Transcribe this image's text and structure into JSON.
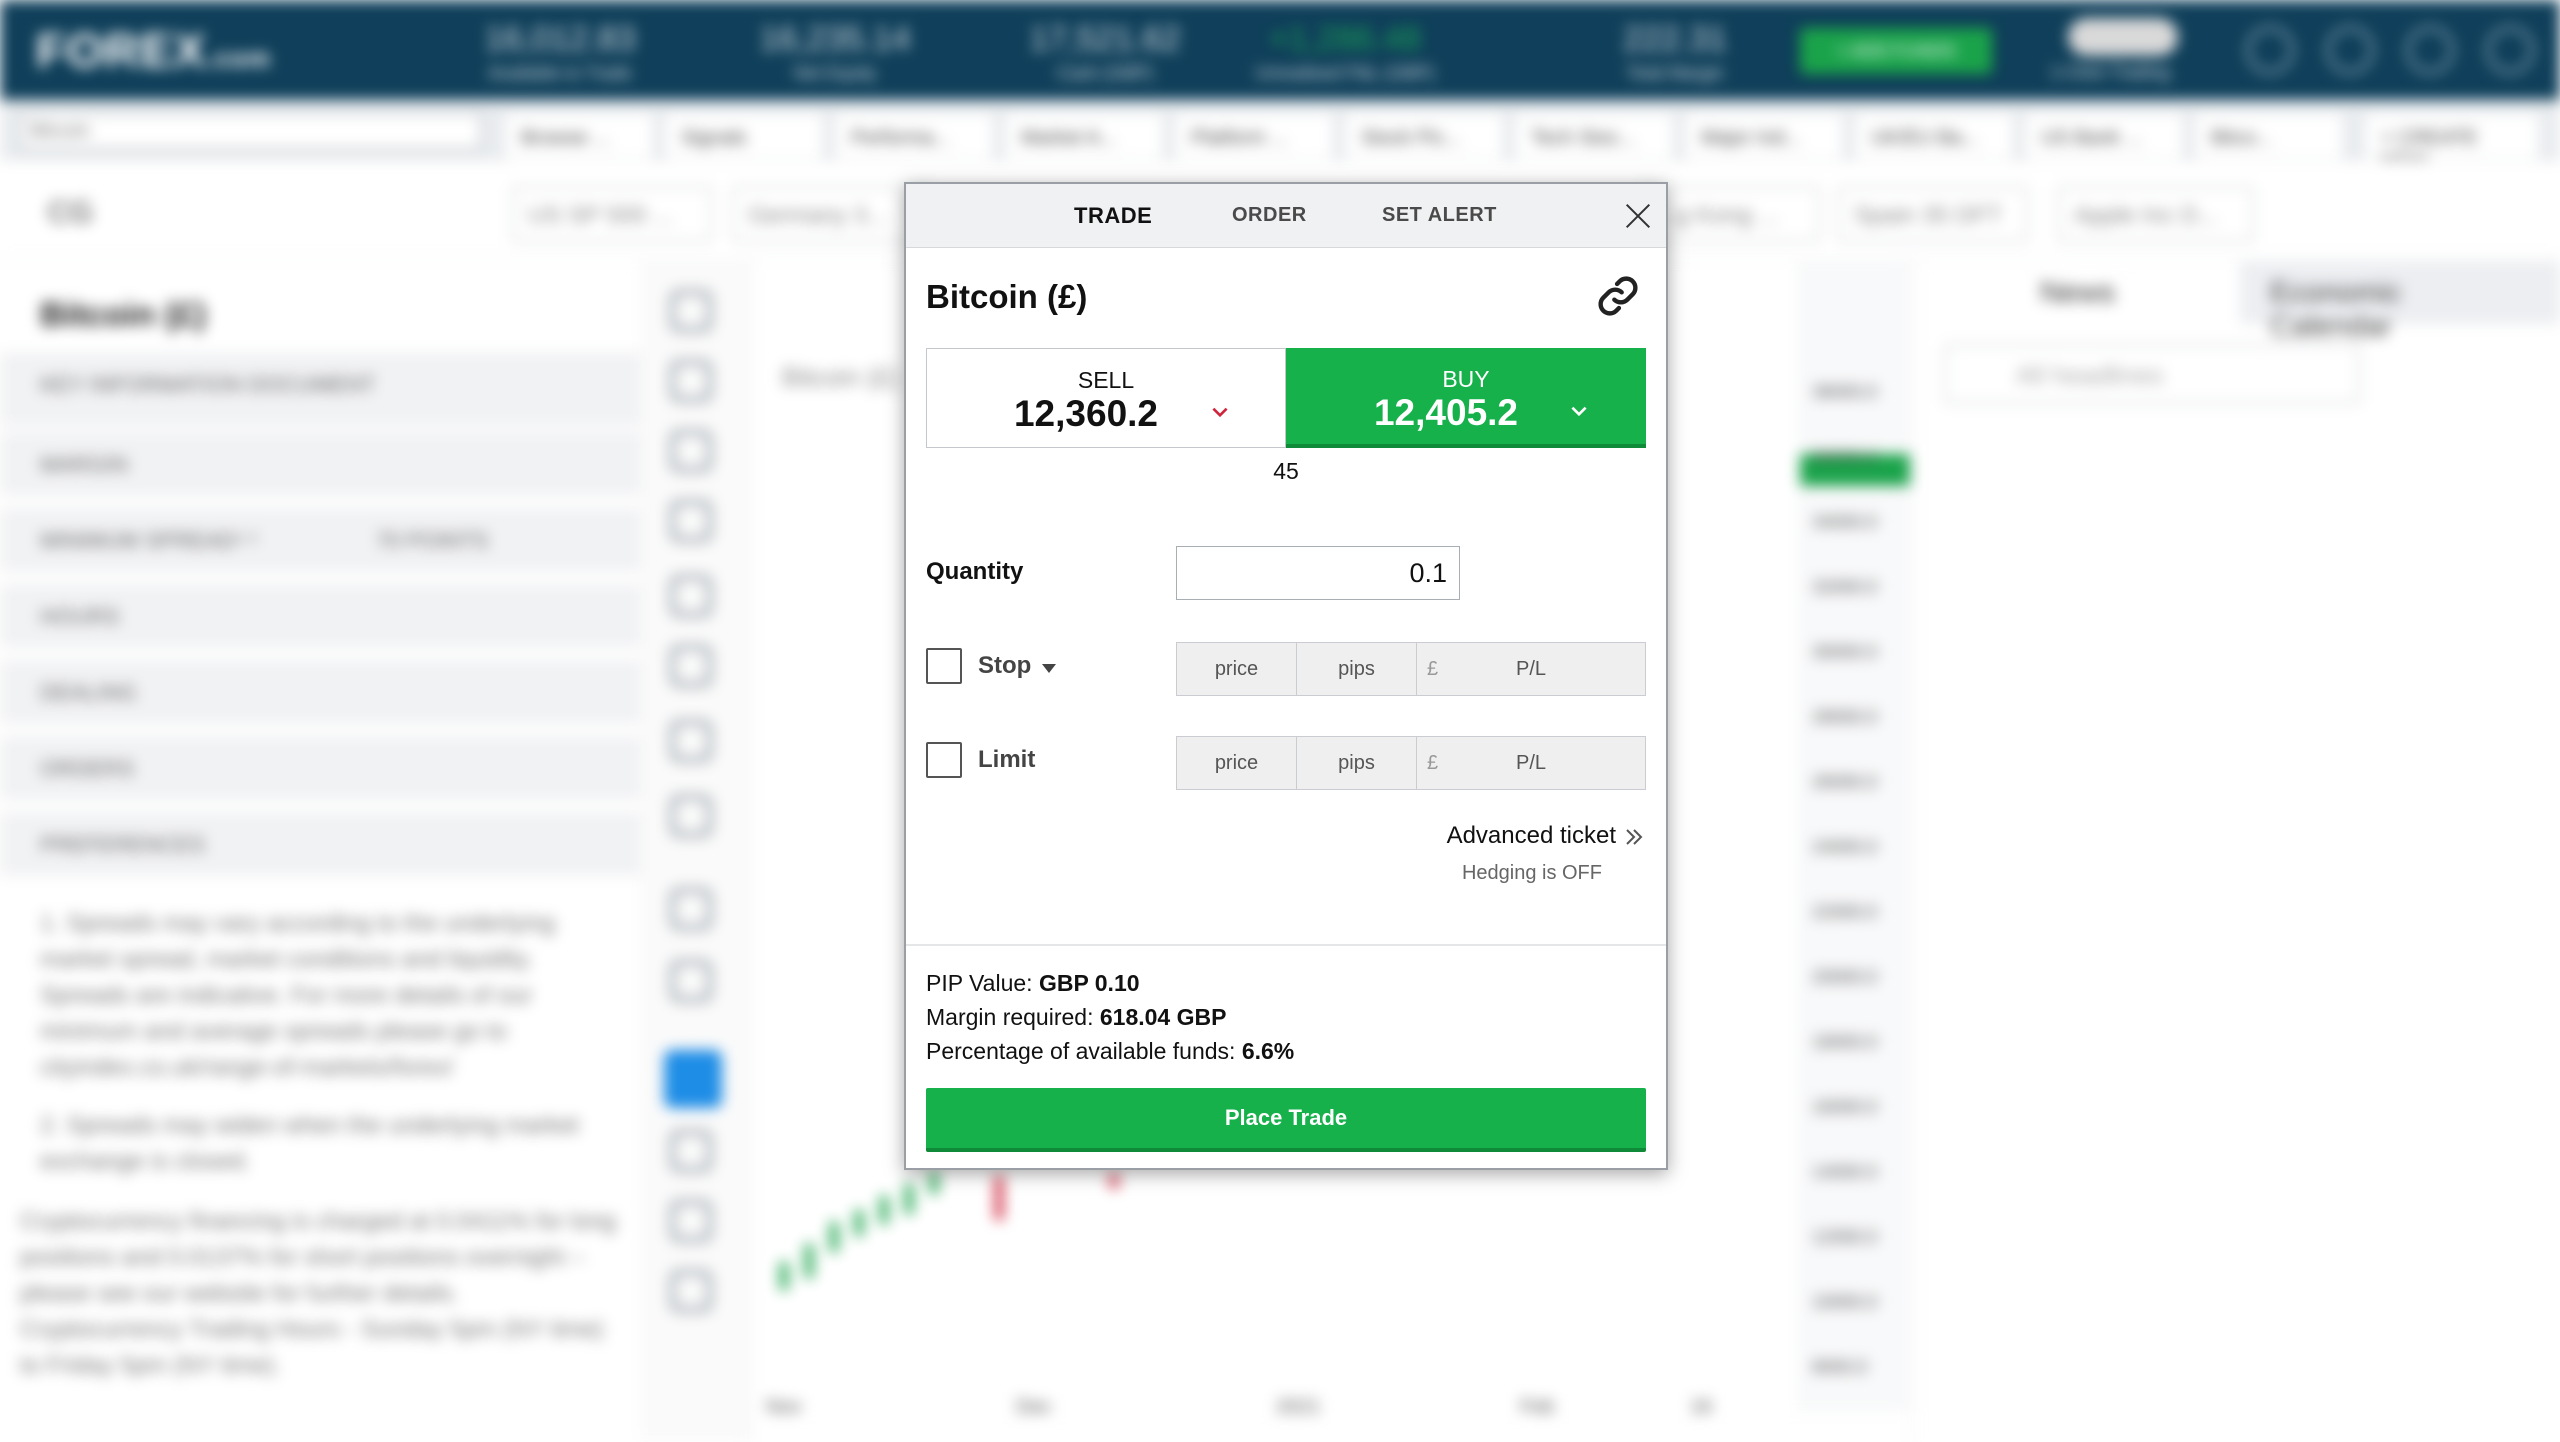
{
  "background": {
    "logo_main": "FOREX",
    "logo_suffix": ".com",
    "stats": [
      {
        "value": "16,012.83",
        "label": "Available to Trade"
      },
      {
        "value": "16,235.14",
        "label": "Net Equity"
      },
      {
        "value": "17,521.62",
        "label": "Cash (GBP)"
      },
      {
        "value": "+1,286.48",
        "label": "Unrealised P&L (GBP)"
      },
      {
        "value": "222.31",
        "label": "Total Margin"
      }
    ],
    "add_funds": "+ ADD FUNDS",
    "one_click_label": "1-Click Trading",
    "search_value": "Bitcoin",
    "tabs": [
      "Browse ...",
      "Signals",
      "Performa...",
      "Market A...",
      "Platform ...",
      "Stock Pic...",
      "Tech Stoc...",
      "Major Ind...",
      "UK/EU Ba...",
      "US Bank ...",
      "Bitco...",
      "+ CREATE NEW"
    ],
    "market_select": "CG",
    "markets": [
      "US SP 500 ...",
      "Germany 3...",
      "...g Kong ...",
      "Spain 35 DFT",
      "Apple Inc D..."
    ],
    "left_title": "Bitcoin (£)",
    "left_rows": [
      "KEY INFORMATION DOCUMENT",
      "MARGIN",
      "MINIMUM SPREAD¹ ²",
      "HOURS",
      "DEALING",
      "ORDERS",
      "PREFERENCES"
    ],
    "left_spread_value": "70 POINTS",
    "footnotes": [
      "1. Spreads may vary according to the underlying market spread, market conditions and liquidity. Spreads are indicative. For more details of our minimum and average spreads please go to cityindex.co.uk/range-of-markets/forex/",
      "2. Spreads may widen when the underlying market exchange is closed.",
      "Cryptocurrency financing is charged at 0.0411% for long positions and 0.0137% for short positions overnight – please see our website for further details. Cryptocurrency Trading Hours - Sunday 5pm (NY time) to Friday 5pm (NY time)."
    ],
    "chart_title": "Bitcoin (£)",
    "y_ticks": [
      "38000.0",
      "36000.0",
      "34000.0",
      "32000.0",
      "30000.0",
      "28000.0",
      "26000.0",
      "24000.0",
      "22000.0",
      "20000.0",
      "18000.0",
      "16000.0",
      "14000.0",
      "12000.0",
      "10000.0",
      "8000.0"
    ],
    "x_ticks": [
      "Nov",
      "Dec",
      "2021",
      "Feb",
      "16"
    ],
    "news_tab": "News",
    "econ_tab": "Economic Calendar",
    "news_search_placeholder": "All headlines"
  },
  "ticket": {
    "tabs": {
      "trade": "TRADE",
      "order": "ORDER",
      "alert": "SET ALERT"
    },
    "title": "Bitcoin (£)",
    "sell": {
      "label": "SELL",
      "price": "12,360.2"
    },
    "buy": {
      "label": "BUY",
      "price": "12,405.2"
    },
    "spread": "45",
    "quantity_label": "Quantity",
    "quantity_value": "0.1",
    "stop_label": "Stop",
    "limit_label": "Limit",
    "field_price": "price",
    "field_pips": "pips",
    "field_currency": "£",
    "field_pl": "P/L",
    "advanced_ticket": "Advanced ticket",
    "hedging": "Hedging is OFF",
    "pip_value_label": "PIP Value:",
    "pip_value": "GBP 0.10",
    "margin_label": "Margin required:",
    "margin_value": "618.04 GBP",
    "pct_label": "Percentage of available funds:",
    "pct_value": "6.6%",
    "place_trade": "Place Trade"
  },
  "colors": {
    "buy_green": "#16b14b",
    "sell_arrow": "#d0243b",
    "header_navy": "#0f3f5a"
  }
}
